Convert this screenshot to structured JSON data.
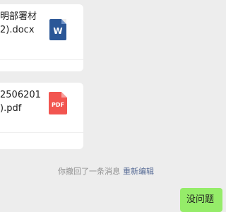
{
  "messages": [
    {
      "type": "file",
      "name_lines": [
        "明部署材",
        "2).docx"
      ],
      "icon": "word-doc-icon",
      "icon_label": "W",
      "icon_color": "#2b5797"
    },
    {
      "type": "file",
      "name_lines": [
        "2506201",
        ").pdf"
      ],
      "icon": "pdf-icon",
      "icon_label": "PDF",
      "icon_color": "#f25550"
    }
  ],
  "recall_notice": {
    "text": "你撤回了一条消息",
    "action": "重新编辑"
  },
  "outgoing_bubble": {
    "text": "没问题",
    "color": "#95ec69"
  }
}
